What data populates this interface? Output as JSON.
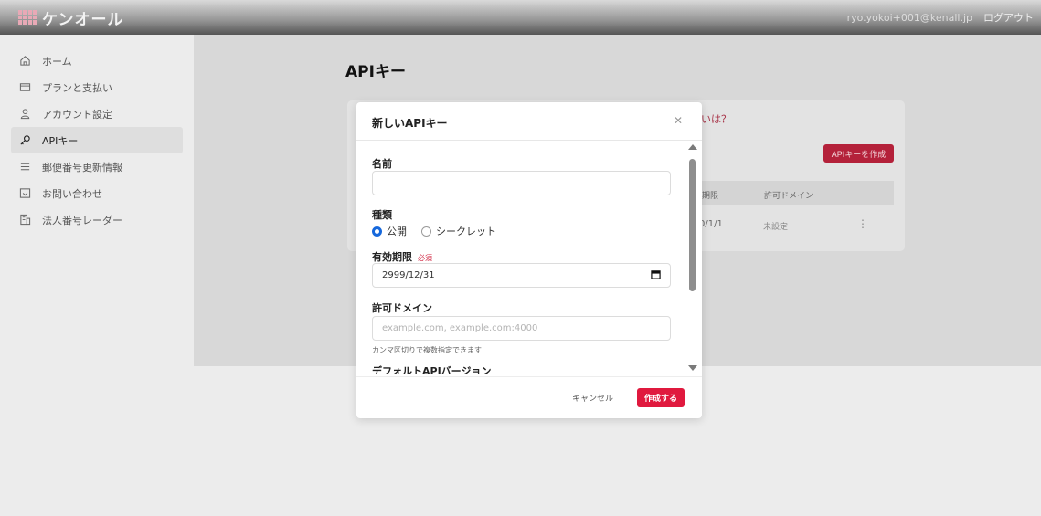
{
  "header": {
    "brand": "ケンオール",
    "user_email": "ryo.yokoi+001@kenall.jp",
    "logout_label": "ログアウト"
  },
  "sidebar": {
    "items": [
      {
        "label": "ホーム",
        "icon": "home-icon"
      },
      {
        "label": "プランと支払い",
        "icon": "credit-card-icon"
      },
      {
        "label": "アカウント設定",
        "icon": "user-icon"
      },
      {
        "label": "APIキー",
        "icon": "key-icon"
      },
      {
        "label": "郵便番号更新情報",
        "icon": "list-icon"
      },
      {
        "label": "お問い合わせ",
        "icon": "inbox-icon"
      },
      {
        "label": "法人番号レーダー",
        "icon": "building-icon"
      }
    ]
  },
  "main": {
    "title": "APIキー",
    "card_link": "いは？",
    "create_button": "APIキーを作成",
    "table_headers": [
      "期限",
      "許可ドメイン"
    ],
    "row": {
      "expiry": "0/1/1",
      "domain": "未設定"
    }
  },
  "modal": {
    "title": "新しいAPIキー",
    "name_label": "名前",
    "name_value": "",
    "type_label": "種類",
    "type_options": [
      "公開",
      "シークレット"
    ],
    "type_selected": "公開",
    "expiry_label": "有効期限",
    "required_label": "必須",
    "expiry_value": "2999/12/31",
    "domain_label": "許可ドメイン",
    "domain_placeholder": "example.com, example.com:4000",
    "domain_hint": "カンマ区切りで複数指定できます",
    "version_label": "デフォルトAPIバージョン",
    "cancel_label": "キャンセル",
    "submit_label": "作成する"
  },
  "colors": {
    "accent": "#e0193e",
    "radio_selected": "#1668dc"
  }
}
